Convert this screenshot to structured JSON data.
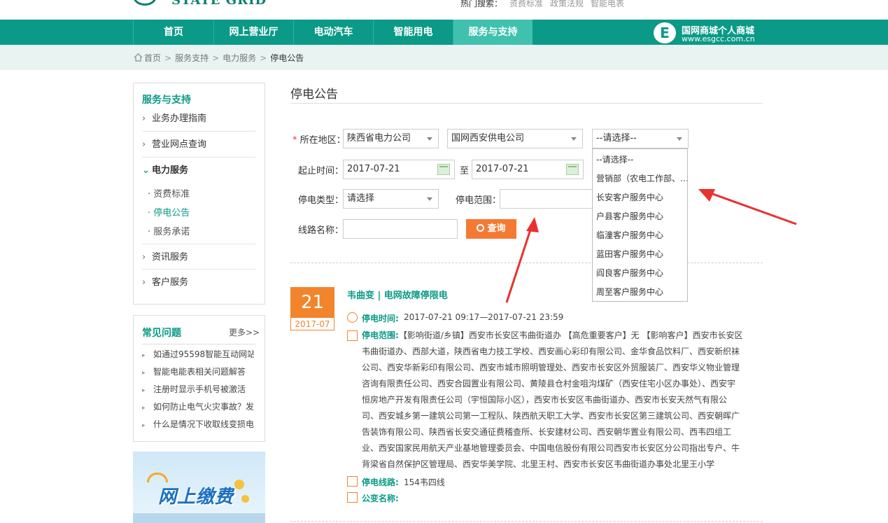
{
  "header": {
    "logo_text": "STATE GRID",
    "hot_label": "热门搜索：",
    "hot_links": [
      "资费标准",
      "政策法规",
      "智能电表"
    ]
  },
  "nav": {
    "items": [
      "首页",
      "网上营业厅",
      "电动汽车",
      "智能用电",
      "服务与支持"
    ],
    "active": "服务与支持",
    "mall_name": "国网商城个人商城",
    "mall_url": "www.esgcc.com.cn"
  },
  "breadcrumb": [
    "首页",
    "服务支持",
    "电力服务",
    "停电公告"
  ],
  "sidebar": {
    "title": "服务与支持",
    "items": [
      "业务办理指南",
      "营业网点查询",
      "电力服务",
      "资讯服务",
      "客户服务"
    ],
    "sub_items": [
      "资费标准",
      "停电公告",
      "服务承诺"
    ],
    "faq_title": "常见问题",
    "faq_more": "更多>>",
    "faq": [
      "如通过95598智能互动网站",
      "智能电能表相关问题解答",
      "注册时显示手机号被激活",
      "如何防止电气火灾事故？发",
      "什么是情况下收取线变损电"
    ],
    "banner_text": "网上缴费"
  },
  "main": {
    "title": "停电公告",
    "form": {
      "region_label": "所在地区：",
      "region_required": "*",
      "province": "陕西省电力公司",
      "city": "国网西安供电公司",
      "district_placeholder": "--请选择--",
      "start_label": "起止时间：",
      "start_date": "2017-07-21",
      "to_label": "至",
      "end_date": "2017-07-21",
      "type_label": "停电类型：",
      "type_value": "请选择",
      "scope_label": "停电范围：",
      "scope_value": "",
      "line_label": "线路名称：",
      "line_value": "",
      "search_button": "查询"
    },
    "dropdown_options": [
      "--请选择--",
      "营销部（农电工作部、…",
      "长安客户服务中心",
      "户县客户服务中心",
      "临潼客户服务中心",
      "蓝田客户服务中心",
      "阎良客户服务中心",
      "周至客户服务中心"
    ],
    "notice": {
      "day": "21",
      "year_month": "2017-07",
      "title": "韦曲变 | 电网故障停限电",
      "time_label": "停电时间:",
      "time_value": "2017-07-21 09:17—2017-07-21 23:59",
      "scope_label": "停电范围:",
      "scope_value": "【影响街道/乡镇】西安市长安区韦曲街道办 【高危重要客户】无 【影响客户】西安市长安区韦曲街道办、西部大道，陕西省电力技工学校、西安画心彩印有限公司、金华食品饮料厂、西安新织袜公司、西安华新彩印有限公司、西安市城市照明管理处、西安市长安区外贸服装厂、西安华义物业管理咨询有限责任公司、西安合园置业有限公司、黄陵县仓村金咀沟煤矿（西安住宅小区办事处）、西安宇恒房地产开发有限责任公司（宇恒国际小区），西安市长安区韦曲街道办、西安市长安天然气有限公司、西安城乡第一建筑公司第一工程队、陕西航天职工大学、西安市长安区第三建筑公司、西安朝晖广告装饰有限公司、陕西省长安交通征费稽查所、长安建材公司、西安朝华置业有限公司、西韦四组工业、西安国家民用航天产业基地管理委员会、中国电信股份有限公司西安市长安区分公司指出专户、牛背梁省自然保护区管理局、西安华美学院、北里王村、西安市长安区韦曲街道办事处北里王小学",
      "line_label": "停电线路:",
      "line_value": "154韦四线",
      "transformer_label": "公变名称:",
      "transformer_value": ""
    }
  },
  "colors": {
    "brand": "#0a9a87",
    "accent": "#f2852c",
    "annotation_arrow": "#e8322f"
  }
}
